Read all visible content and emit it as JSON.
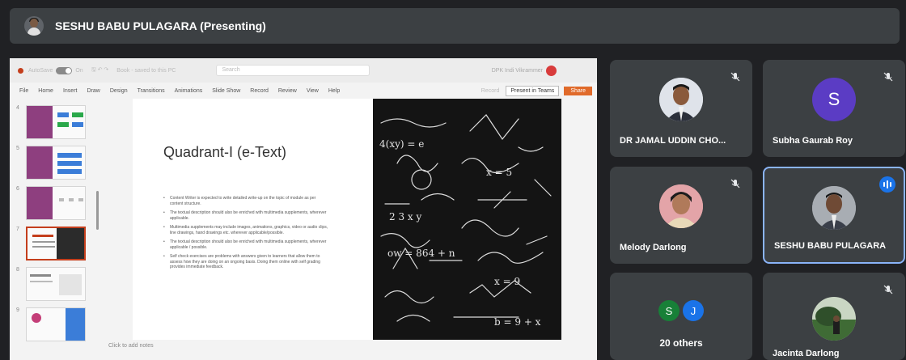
{
  "presenter": {
    "name": "SESHU BABU PULAGARA (Presenting)"
  },
  "ppt": {
    "titlebar": {
      "autosave": "AutoSave",
      "toggle": "On",
      "doc_title": "Book - saved to this PC",
      "search": "Search",
      "user": "DPK Indi Vikrammer"
    },
    "ribbon_tabs": [
      "File",
      "Home",
      "Insert",
      "Draw",
      "Design",
      "Transitions",
      "Animations",
      "Slide Show",
      "Record",
      "Review",
      "View",
      "Help"
    ],
    "record_label": "Record",
    "present_teams_label": "Present in Teams",
    "share_label": "Share",
    "thumb_numbers": [
      "4",
      "5",
      "6",
      "7",
      "8",
      "9"
    ],
    "notes_placeholder": "Click to add notes"
  },
  "slide": {
    "title": "Quadrant-I (e-Text)",
    "bullets": [
      "Content Writer is expected to write detailed write-up on the topic of module as per content structure.",
      "The textual description should also be enriched with multimedia supplements, wherever applicable.",
      "Multimedia supplements may include images, animations, graphics, video or audio clips, line drawings, hand drawings etc. wherever applicable/possible.",
      "The textual description should also be enriched with multimedia supplements, wherever applicable / possible.",
      "Self check exercises are problems with answers given to learners that allow them to assess how they are doing on an ongoing basis. Doing them online with self grading provides immediate feedback."
    ]
  },
  "participants": [
    {
      "name": "DR JAMAL UDDIN CHO...",
      "muted": true
    },
    {
      "name": "Subha Gaurab Roy",
      "muted": true,
      "initial": "S",
      "color": "#5b3cc4"
    },
    {
      "name": "Melody Darlong",
      "muted": true
    },
    {
      "name": "SESHU BABU PULAGARA",
      "speaking": true
    },
    {
      "name": "20 others",
      "initials": [
        "S",
        "J"
      ],
      "colors": [
        "#188038",
        "#1a73e8"
      ]
    },
    {
      "name": "Jacinta Darlong",
      "muted": true
    }
  ],
  "colors": {
    "accent": "#8ab4f8",
    "tile": "#3c4043",
    "background": "#202124",
    "ppt_accent": "#c43e1c"
  }
}
